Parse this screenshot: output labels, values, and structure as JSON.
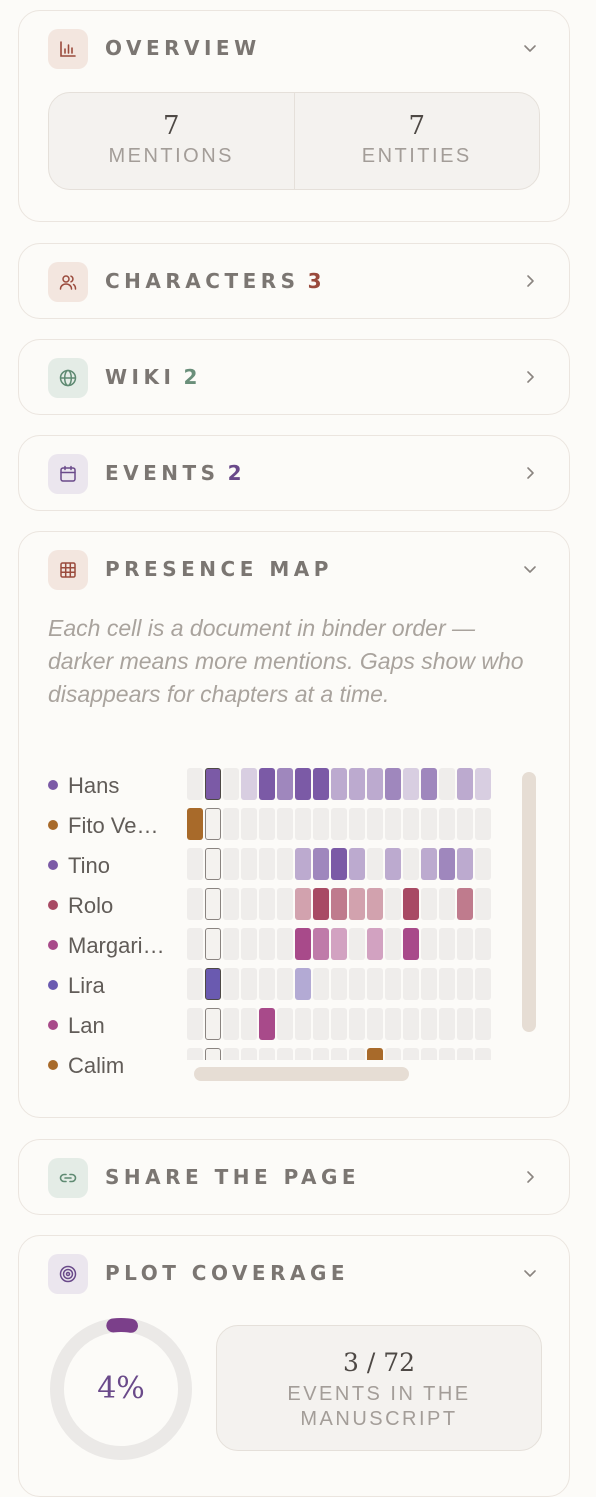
{
  "overview": {
    "title": "OVERVIEW",
    "icon": "bar-chart-icon",
    "stats": [
      {
        "value": "7",
        "label": "MENTIONS"
      },
      {
        "value": "7",
        "label": "ENTITIES"
      }
    ]
  },
  "characters": {
    "title": "CHARACTERS",
    "count": "3",
    "icon": "users-icon",
    "count_color": "#9a4a3c"
  },
  "wiki": {
    "title": "WIKI",
    "count": "2",
    "icon": "globe-icon",
    "count_color": "#6a8f7a"
  },
  "events": {
    "title": "EVENTS",
    "count": "2",
    "icon": "calendar-icon",
    "count_color": "#6a4a8a"
  },
  "presence": {
    "title": "PRESENCE MAP",
    "icon": "grid-icon",
    "description": "Each cell is a document in binder order — darker means more mentions. Gaps show who disappears for chapters at a time.",
    "characters": [
      {
        "name": "Hans",
        "color": "#7b5aa6",
        "cells": [
          0,
          4,
          0,
          1,
          4,
          3,
          4,
          4,
          2,
          2,
          2,
          3,
          1,
          3,
          0,
          2,
          1
        ]
      },
      {
        "name": "Fito Ve…",
        "color": "#a86a2a",
        "cells": [
          4,
          5,
          0,
          0,
          0,
          0,
          0,
          0,
          0,
          0,
          0,
          0,
          0,
          0,
          0,
          0,
          0
        ]
      },
      {
        "name": "Tino",
        "color": "#7b5aa6",
        "cells": [
          0,
          5,
          0,
          0,
          0,
          0,
          2,
          3,
          4,
          2,
          0,
          2,
          0,
          2,
          3,
          2,
          0
        ]
      },
      {
        "name": "Rolo",
        "color": "#a84a64",
        "cells": [
          0,
          5,
          0,
          0,
          0,
          0,
          2,
          4,
          3,
          2,
          2,
          0,
          4,
          0,
          0,
          3,
          0
        ]
      },
      {
        "name": "Margari…",
        "color": "#a84a8a",
        "cells": [
          0,
          5,
          0,
          0,
          0,
          0,
          4,
          3,
          2,
          0,
          2,
          0,
          4,
          0,
          0,
          0,
          0
        ]
      },
      {
        "name": "Lira",
        "color": "#6a5ab0",
        "cells": [
          0,
          4,
          0,
          0,
          0,
          0,
          2,
          0,
          0,
          0,
          0,
          0,
          0,
          0,
          0,
          0,
          0
        ]
      },
      {
        "name": "Lan",
        "color": "#a84a8a",
        "cells": [
          0,
          5,
          0,
          0,
          4,
          0,
          0,
          0,
          0,
          0,
          0,
          0,
          0,
          0,
          0,
          0,
          0
        ]
      },
      {
        "name": "Calim",
        "color": "#a86a2a",
        "cells": [
          0,
          5,
          0,
          0,
          0,
          0,
          0,
          0,
          0,
          0,
          4,
          0,
          0,
          0,
          0,
          0,
          0
        ]
      }
    ]
  },
  "share": {
    "title": "SHARE THE PAGE",
    "icon": "link-icon"
  },
  "plot": {
    "title": "PLOT COVERAGE",
    "icon": "target-icon",
    "percent_label": "4%",
    "percent": 0.04,
    "accent": "#7b3f8a",
    "events_value": "3 / 72",
    "events_label": "EVENTS IN THE MANUSCRIPT"
  }
}
